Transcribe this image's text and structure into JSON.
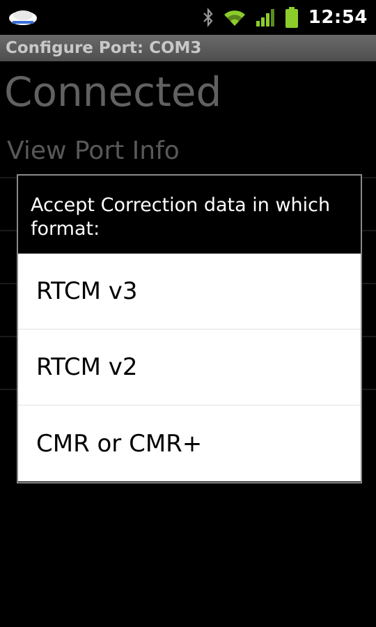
{
  "status_bar": {
    "time": "12:54",
    "icons": [
      "app-notification-icon",
      "bluetooth-icon",
      "wifi-icon",
      "signal-icon",
      "battery-icon"
    ]
  },
  "title_bar": {
    "title": "Configure Port: COM3"
  },
  "background": {
    "status": "Connected",
    "menu_items": [
      "View Port Info",
      "",
      "",
      "",
      ""
    ]
  },
  "dialog": {
    "title": "Accept Correction data in which format:",
    "options": [
      "RTCM v3",
      "RTCM v2",
      "CMR or CMR+"
    ]
  },
  "colors": {
    "wifi": "#8ccd2c",
    "battery": "#8ccd2c",
    "title_bar": "#5a5a5a"
  }
}
